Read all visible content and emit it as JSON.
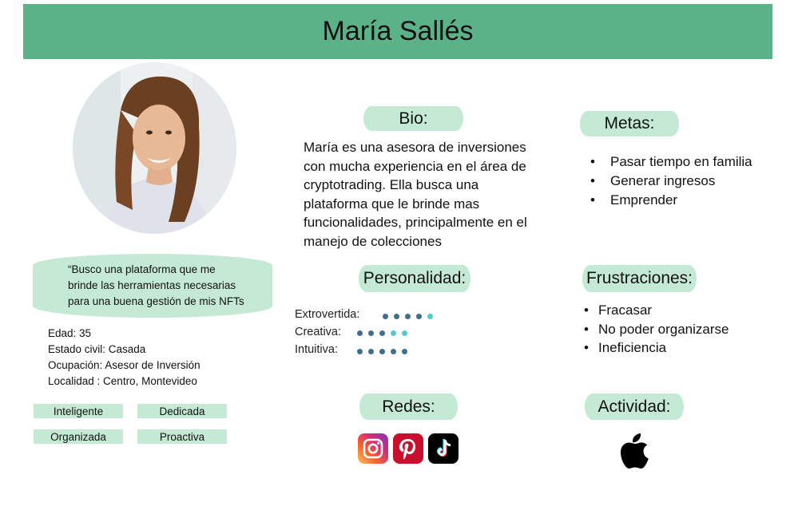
{
  "persona": {
    "name": "María Sallés",
    "quote": [
      "“Busco una plataforma que me",
      "brinde las herramientas necesarias",
      "para una buena gestión de mis NFTs"
    ],
    "info": [
      "Edad: 35",
      "Estado civil: Casada",
      "Ocupación: Asesor de Inversión",
      "Localidad : Centro, Montevideo"
    ],
    "traits": [
      "Inteligente",
      "Dedicada",
      "Organizada",
      "Proactiva"
    ]
  },
  "bio": {
    "heading": "Bio:",
    "text": [
      "María es una asesora de inversiones",
      "con mucha experiencia en el área de",
      "cryptotrading. Ella busca una",
      "plataforma que le brinde mas",
      "funcionalidades, principalmente en el",
      "manejo de colecciones"
    ]
  },
  "goals": {
    "heading": "Metas:",
    "items": [
      "Pasar tiempo en familia",
      "Generar ingresos",
      "Emprender"
    ]
  },
  "personality": {
    "heading": "Personalidad:",
    "traits": [
      {
        "label": "Extrovertida:",
        "level": 5
      },
      {
        "label": "Creativa:",
        "level": 5
      },
      {
        "label": "Intuitiva:",
        "level": 5
      }
    ],
    "colors": {
      "base": "#3f6e8f",
      "accent": "#4ccfc8"
    }
  },
  "frustrations": {
    "heading": "Frustraciones:",
    "items": [
      "Fracasar",
      "No poder organizarse",
      "Ineficiencia"
    ]
  },
  "networks": {
    "heading": "Redes:",
    "icons": [
      "instagram-icon",
      "pinterest-icon",
      "tiktok-icon"
    ]
  },
  "activity": {
    "heading": "Actividad:",
    "icon": "apple-icon"
  },
  "colors": {
    "header": "#5bb288",
    "pill": "#c4ead6"
  }
}
